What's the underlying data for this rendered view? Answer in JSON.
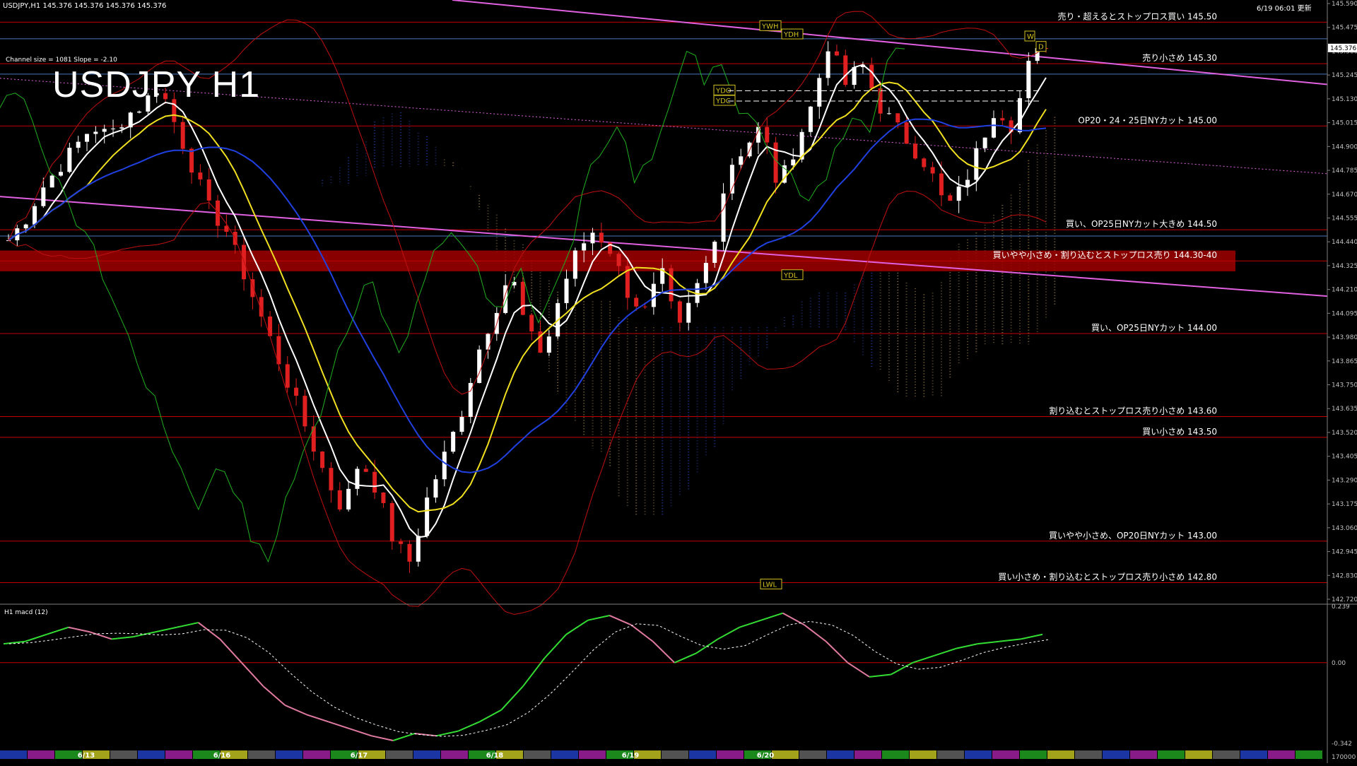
{
  "header": {
    "symbol_info": "USDJPY,H1  145.376 145.376 145.376 145.376",
    "updated": "6/19 06:01 更新",
    "channel_info": "Channel size = 1081 Slope = -2.10",
    "big_title": "USDJPY H1"
  },
  "chart_data": {
    "type": "candlestick",
    "title": "USDJPY H1",
    "ylim": [
      142.72,
      145.59
    ],
    "y_ticks": [
      "145.590",
      "145.475",
      "145.360",
      "145.245",
      "145.130",
      "145.015",
      "144.900",
      "144.785",
      "144.670",
      "144.555",
      "144.440",
      "144.325",
      "144.210",
      "144.095",
      "143.980",
      "143.865",
      "143.750",
      "143.635",
      "143.520",
      "143.405",
      "143.290",
      "143.175",
      "143.060",
      "142.945",
      "142.830",
      "142.720"
    ],
    "current_price": "145.376",
    "x_dates": [
      "6/13",
      "6/16",
      "6/17",
      "6/18",
      "6/19",
      "6/20"
    ],
    "close_path": [
      144.45,
      144.55,
      144.7,
      144.8,
      144.9,
      145.0,
      144.95,
      145.05,
      145.1,
      145.2,
      145.0,
      144.8,
      144.6,
      144.5,
      144.3,
      144.1,
      143.9,
      143.7,
      143.5,
      143.3,
      143.15,
      143.4,
      143.25,
      143.0,
      142.9,
      143.2,
      143.4,
      143.6,
      143.9,
      144.1,
      144.3,
      144.0,
      143.9,
      144.2,
      144.4,
      144.5,
      144.4,
      144.2,
      144.1,
      144.3,
      144.0,
      144.2,
      144.4,
      144.8,
      144.9,
      145.0,
      144.7,
      144.9,
      145.1,
      145.4,
      145.2,
      145.3,
      145.1,
      145.0,
      144.9,
      144.8,
      144.6,
      144.7,
      144.9,
      145.1,
      145.0,
      145.3,
      145.4
    ],
    "levels": [
      {
        "price": 145.5,
        "label": "売り・超えるとストップロス買い 145.50"
      },
      {
        "price": 145.3,
        "label": "売り小さめ 145.30"
      },
      {
        "price": 145.0,
        "label": "OP20・24・25日NYカット 145.00"
      },
      {
        "price": 144.5,
        "label": "買い、OP25日NYカット大きめ 144.50"
      },
      {
        "price": 144.35,
        "label": "買いやや小さめ・割り込むとストップロス売り 144.30-40"
      },
      {
        "price": 144.0,
        "label": "買い、OP25日NYカット 144.00"
      },
      {
        "price": 143.6,
        "label": "割り込むとストップロス売り小さめ 143.60"
      },
      {
        "price": 143.5,
        "label": "買い小さめ 143.50"
      },
      {
        "price": 143.0,
        "label": "買いやや小さめ、OP20日NYカット 143.00"
      },
      {
        "price": 142.8,
        "label": "買い小さめ・割り込むとストップロス売り小さめ 142.80"
      }
    ],
    "markers": [
      "YWH",
      "YDH",
      "YDO",
      "YDC",
      "YDL",
      "LWL",
      "W",
      "D"
    ],
    "macd": {
      "label": "H1  macd (12)",
      "ticks": [
        "0.239",
        "0.00",
        "-0.342"
      ],
      "ylim": [
        -0.342,
        0.239
      ],
      "values": [
        0.08,
        0.09,
        0.12,
        0.15,
        0.13,
        0.1,
        0.11,
        0.13,
        0.15,
        0.17,
        0.1,
        0.0,
        -0.1,
        -0.18,
        -0.22,
        -0.25,
        -0.28,
        -0.31,
        -0.33,
        -0.3,
        -0.31,
        -0.29,
        -0.25,
        -0.2,
        -0.1,
        0.02,
        0.12,
        0.18,
        0.2,
        0.16,
        0.09,
        0.0,
        0.04,
        0.1,
        0.15,
        0.18,
        0.21,
        0.16,
        0.09,
        0.0,
        -0.06,
        -0.05,
        0.0,
        0.03,
        0.06,
        0.08,
        0.09,
        0.1,
        0.12
      ]
    },
    "volume_tick": "170000"
  },
  "colors": {
    "background": "#000000",
    "level_line": "#c00000",
    "blue_line": "#4a78c0",
    "label_text": "#ffffff",
    "macd_up": "#33dd33",
    "macd_down": "#e07aa0",
    "pink_channel": "#e060e0",
    "zone": "#a00000"
  }
}
